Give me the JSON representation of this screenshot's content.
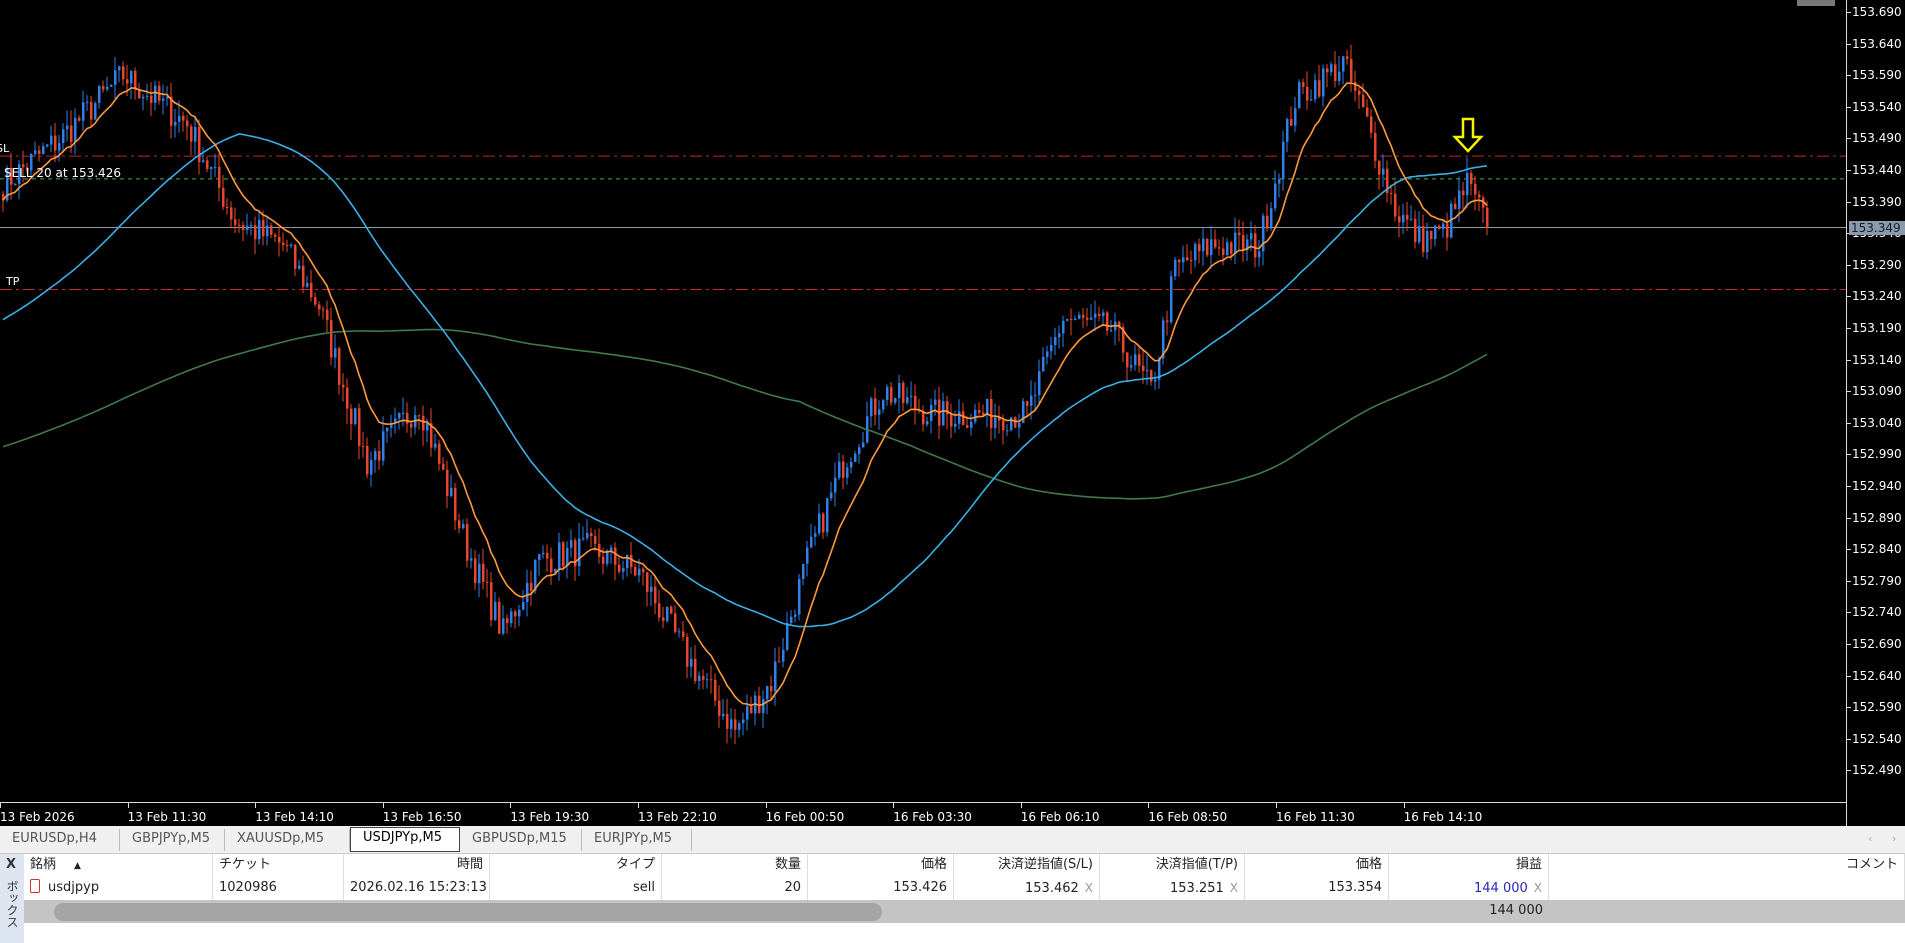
{
  "window": {
    "scroll_icon": "scroll-thumb"
  },
  "chart": {
    "symbol": "USDJPYp",
    "timeframe": "M5",
    "colors": {
      "bull": "#2f80ea",
      "bear": "#e8462e",
      "ema_fast": "#ff9a3c",
      "ma_mid": "#3ab0e8",
      "ma_slow": "#3e7a4c",
      "sl_line": "#c0282a",
      "tp_line": "#c0282a",
      "entry_line": "#4caf50",
      "bid_line": "#8a9aa8",
      "arrow": "#f5f500"
    },
    "price_ticks": [
      "153.690",
      "153.640",
      "153.590",
      "153.540",
      "153.490",
      "153.440",
      "153.390",
      "153.340",
      "153.290",
      "153.240",
      "153.190",
      "153.140",
      "153.090",
      "153.040",
      "152.990",
      "152.940",
      "152.890",
      "152.840",
      "152.790",
      "152.740",
      "152.690",
      "152.640",
      "152.590",
      "152.540",
      "152.490"
    ],
    "current_price": "153.349",
    "time_ticks": [
      "13 Feb 2026",
      "13 Feb 11:30",
      "13 Feb 14:10",
      "13 Feb 16:50",
      "13 Feb 19:30",
      "13 Feb 22:10",
      "16 Feb 00:50",
      "16 Feb 03:30",
      "16 Feb 06:10",
      "16 Feb 08:50",
      "16 Feb 11:30",
      "16 Feb 14:10"
    ],
    "labels": {
      "sl": "SL",
      "entry": "SELL 20 at 153.426",
      "tp": "TP"
    },
    "levels": {
      "sl": 153.462,
      "entry": 153.426,
      "bid": 153.349,
      "tp": 153.251
    },
    "signal_arrow": {
      "direction": "down",
      "price": 153.47
    }
  },
  "chart_data": {
    "type": "candlestick",
    "ylim": [
      152.47,
      153.705
    ],
    "moving_averages": [
      "EMA fast (orange)",
      "MA mid (blue)",
      "MA slow (green)"
    ],
    "approx_close_path": [
      [
        0,
        153.417
      ],
      [
        15,
        153.494
      ],
      [
        30,
        153.59
      ],
      [
        46,
        153.513
      ],
      [
        58,
        153.36
      ],
      [
        70,
        153.321
      ],
      [
        79,
        153.225
      ],
      [
        91,
        152.976
      ],
      [
        104,
        153.072
      ],
      [
        116,
        152.841
      ],
      [
        125,
        152.707
      ],
      [
        134,
        152.822
      ],
      [
        146,
        152.841
      ],
      [
        159,
        152.803
      ],
      [
        171,
        152.669
      ],
      [
        183,
        152.553
      ],
      [
        192,
        152.63
      ],
      [
        201,
        152.822
      ],
      [
        210,
        152.976
      ],
      [
        220,
        153.091
      ],
      [
        232,
        153.053
      ],
      [
        244,
        153.053
      ],
      [
        256,
        153.053
      ],
      [
        265,
        153.206
      ],
      [
        277,
        153.187
      ],
      [
        287,
        153.091
      ],
      [
        293,
        153.283
      ],
      [
        302,
        153.321
      ],
      [
        314,
        153.321
      ],
      [
        323,
        153.552
      ],
      [
        335,
        153.609
      ],
      [
        341,
        153.513
      ],
      [
        348,
        153.379
      ],
      [
        354,
        153.331
      ],
      [
        360,
        153.34
      ],
      [
        366,
        153.417
      ],
      [
        371,
        153.349
      ]
    ]
  },
  "tabs": [
    "EURUSDp,H4",
    "GBPJPYp,M5",
    "XAUUSDp,M5",
    "USDJPYp,M5",
    "GBPUSDp,M15",
    "EURJPYp,M5"
  ],
  "active_tab": "USDJPYp,M5",
  "toolbox": {
    "close": "X",
    "title": "ボックス",
    "sort_icon": "▲",
    "headers": [
      "銘柄",
      "チケット",
      "時間",
      "タイプ",
      "数量",
      "価格",
      "決済逆指値(S/L)",
      "決済指値(T/P)",
      "価格",
      "損益",
      "コメント"
    ],
    "rows": [
      {
        "symbol": "usdjpyp",
        "ticket": "1020986",
        "time": "2026.02.16 15:23:13",
        "type": "sell",
        "volume": "20",
        "open_price": "153.426",
        "sl": "153.462",
        "tp": "153.251",
        "price": "153.354",
        "profit": "144 000",
        "comment": ""
      }
    ],
    "total_profit": "144 000",
    "remove": "X"
  }
}
